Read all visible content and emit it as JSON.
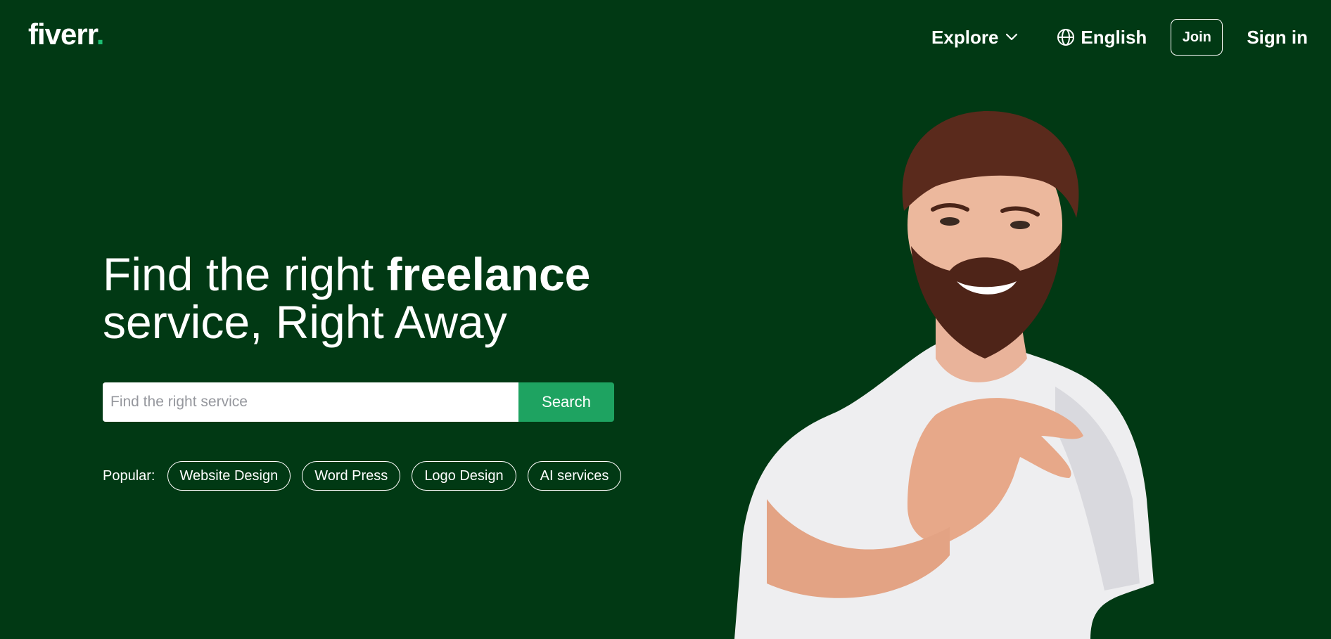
{
  "header": {
    "logo_text": "fiverr",
    "logo_dot": ".",
    "nav": {
      "explore_label": "Explore",
      "language_label": "English",
      "join_label": "Join",
      "signin_label": "Sign in"
    }
  },
  "hero": {
    "headline_part1": "Find the right ",
    "headline_bold": "freelance",
    "headline_part2": "service, Right Away",
    "search": {
      "placeholder": "Find the right service",
      "value": "",
      "button_label": "Search"
    },
    "popular": {
      "label": "Popular:",
      "tags": [
        "Website Design",
        "Word Press",
        "Logo Design",
        "AI services"
      ]
    }
  },
  "icons": {
    "explore_chevron": "chevron-down-icon",
    "language": "globe-icon"
  },
  "colors": {
    "background": "#013914",
    "accent": "#1dbf73",
    "search_button": "#1ea361",
    "text": "#ffffff"
  }
}
